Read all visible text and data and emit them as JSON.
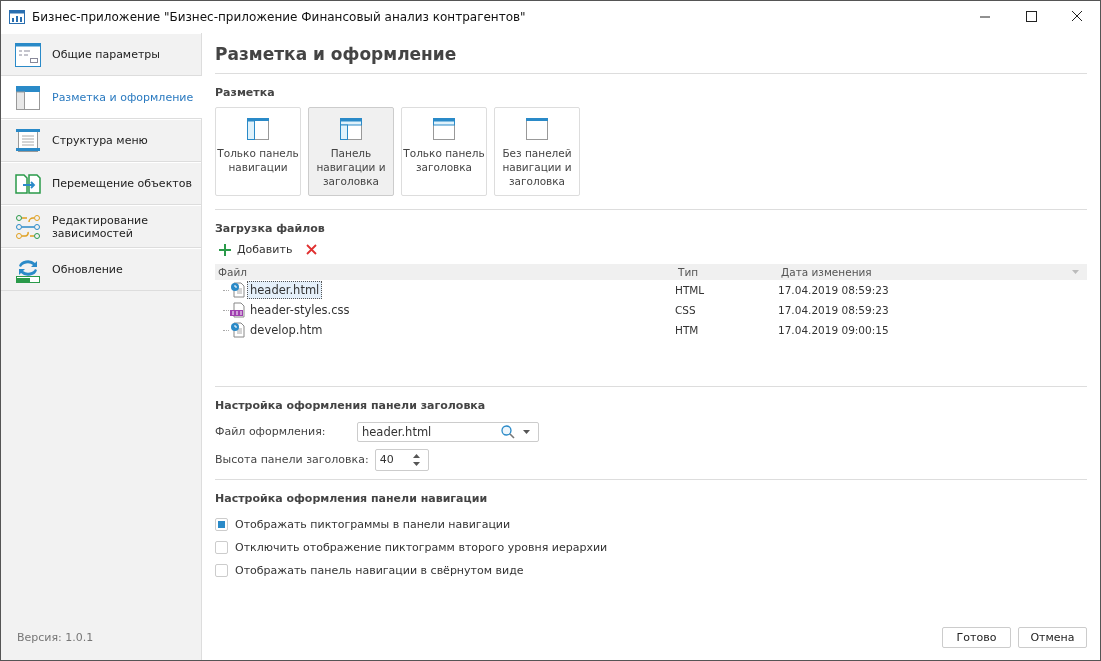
{
  "window": {
    "title": "Бизнес-приложение \"Бизнес-приложение Финансовый анализ контрагентов\""
  },
  "sidebar": {
    "items": [
      {
        "kind": "params",
        "label": "Общие параметры",
        "selected": false
      },
      {
        "kind": "layout",
        "label": "Разметка и оформление",
        "selected": true
      },
      {
        "kind": "menu",
        "label": "Структура меню",
        "selected": false
      },
      {
        "kind": "move",
        "label": "Перемещение объектов",
        "selected": false
      },
      {
        "kind": "deps",
        "label": "Редактирование зависимостей",
        "selected": false
      },
      {
        "kind": "update",
        "label": "Обновление",
        "selected": false
      }
    ],
    "version": "Версия: 1.0.1"
  },
  "page_title": "Разметка и оформление",
  "layout_section": {
    "title": "Разметка",
    "options": [
      {
        "kind": "nav",
        "label": "Только панель навигации",
        "selected": false
      },
      {
        "kind": "both",
        "label": "Панель навигации и заголовка",
        "selected": true
      },
      {
        "kind": "header",
        "label": "Только панель заголовка",
        "selected": false
      },
      {
        "kind": "none",
        "label": "Без панелей навигации и заголовка",
        "selected": false
      }
    ]
  },
  "files_section": {
    "title": "Загрузка файлов",
    "add_button": "Добавить",
    "table": {
      "columns": [
        "Файл",
        "Тип",
        "Дата изменения"
      ],
      "rows": [
        {
          "kind": "html",
          "name": "header.html",
          "type": "HTML",
          "date": "17.04.2019 08:59:23",
          "selected": true
        },
        {
          "kind": "css",
          "name": "header-styles.css",
          "type": "CSS",
          "date": "17.04.2019 08:59:23",
          "selected": false
        },
        {
          "kind": "html",
          "name": "develop.htm",
          "type": "HTM",
          "date": "17.04.2019 09:00:15",
          "selected": false
        }
      ]
    }
  },
  "header_section": {
    "title": "Настройка оформления панели заголовка",
    "file_label": "Файл оформления:",
    "file_value": "header.html",
    "height_label": "Высота панели заголовка:",
    "height_value": "40"
  },
  "nav_section": {
    "title": "Настройка оформления панели навигации",
    "options": [
      {
        "label": "Отображать пиктограммы в панели навигации",
        "checked": true
      },
      {
        "label": "Отключить отображение пиктограмм второго уровня иерархии",
        "checked": false
      },
      {
        "label": "Отображать панель навигации в свёрнутом виде",
        "checked": false
      }
    ]
  },
  "buttons": [
    "Готово",
    "Отмена"
  ]
}
